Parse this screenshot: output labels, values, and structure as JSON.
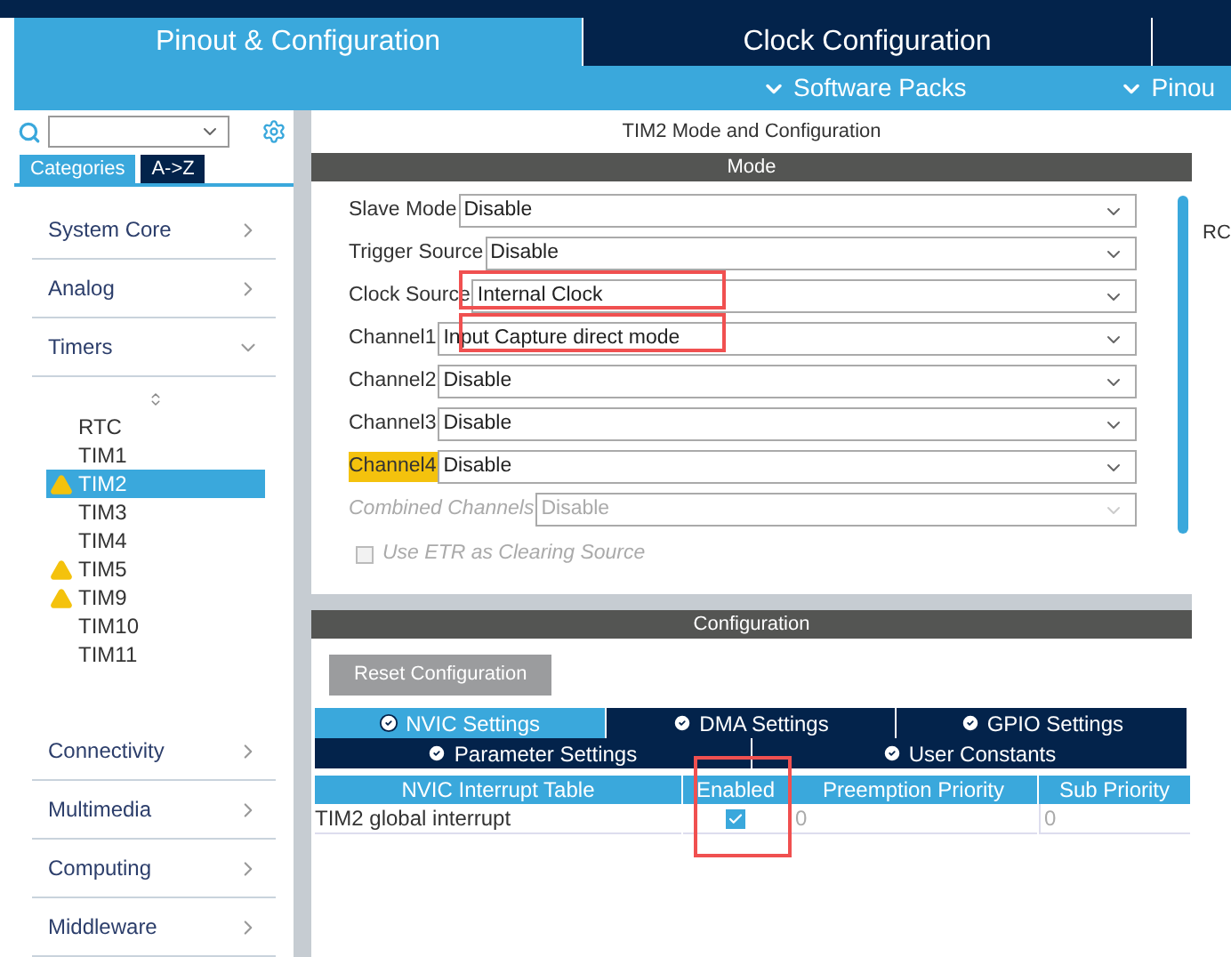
{
  "main_tabs": [
    {
      "label": "Pinout & Configuration",
      "selected": true
    },
    {
      "label": "Clock Configuration",
      "selected": false
    }
  ],
  "sub_menus": [
    "Software Packs",
    "Pinou"
  ],
  "sidebar": {
    "view_tabs": [
      {
        "label": "Categories",
        "selected": true
      },
      {
        "label": "A->Z",
        "selected": false
      }
    ],
    "categories": [
      {
        "label": "System Core",
        "expanded": false
      },
      {
        "label": "Analog",
        "expanded": false
      },
      {
        "label": "Timers",
        "expanded": true,
        "children": [
          {
            "label": "RTC",
            "warning": false,
            "selected": false
          },
          {
            "label": "TIM1",
            "warning": false,
            "selected": false
          },
          {
            "label": "TIM2",
            "warning": true,
            "selected": true
          },
          {
            "label": "TIM3",
            "warning": false,
            "selected": false
          },
          {
            "label": "TIM4",
            "warning": false,
            "selected": false
          },
          {
            "label": "TIM5",
            "warning": true,
            "selected": false
          },
          {
            "label": "TIM9",
            "warning": true,
            "selected": false
          },
          {
            "label": "TIM10",
            "warning": false,
            "selected": false
          },
          {
            "label": "TIM11",
            "warning": false,
            "selected": false
          }
        ]
      },
      {
        "label": "Connectivity",
        "expanded": false
      },
      {
        "label": "Multimedia",
        "expanded": false
      },
      {
        "label": "Computing",
        "expanded": false
      },
      {
        "label": "Middleware",
        "expanded": false
      }
    ]
  },
  "panel_title": "TIM2 Mode and Configuration",
  "mode": {
    "title": "Mode",
    "fields": [
      {
        "label": "Slave Mode",
        "value": "Disable",
        "disabled": false,
        "warning": false,
        "highlighted": false
      },
      {
        "label": "Trigger Source",
        "value": "Disable",
        "disabled": false,
        "warning": false,
        "highlighted": false
      },
      {
        "label": "Clock Source",
        "value": "Internal Clock",
        "disabled": false,
        "warning": false,
        "highlighted": true
      },
      {
        "label": "Channel1",
        "value": "Input Capture direct mode",
        "disabled": false,
        "warning": false,
        "highlighted": true
      },
      {
        "label": "Channel2",
        "value": "Disable",
        "disabled": false,
        "warning": false,
        "highlighted": false
      },
      {
        "label": "Channel3",
        "value": "Disable",
        "disabled": false,
        "warning": false,
        "highlighted": false
      },
      {
        "label": "Channel4",
        "value": "Disable",
        "disabled": false,
        "warning": true,
        "highlighted": false
      },
      {
        "label": "Combined Channels",
        "value": "Disable",
        "disabled": true,
        "warning": false,
        "highlighted": false
      }
    ],
    "checkbox": {
      "label": "Use ETR as Clearing Source",
      "checked": false,
      "disabled": true
    }
  },
  "configuration": {
    "title": "Configuration",
    "reset_button": "Reset Configuration",
    "tabs_row_1": [
      {
        "label": "NVIC Settings",
        "selected": true
      },
      {
        "label": "DMA Settings",
        "selected": false
      },
      {
        "label": "GPIO Settings",
        "selected": false
      }
    ],
    "tabs_row_2": [
      {
        "label": "Parameter Settings",
        "selected": false
      },
      {
        "label": "User Constants",
        "selected": false
      }
    ],
    "table": {
      "columns": [
        "NVIC Interrupt Table",
        "Enabled",
        "Preemption Priority",
        "Sub Priority"
      ],
      "rows": [
        {
          "name": "TIM2 global interrupt",
          "enabled": true,
          "enabled_highlighted": true,
          "preemption_priority": "0",
          "sub_priority": "0"
        }
      ]
    }
  },
  "right_edge_text": "RC"
}
